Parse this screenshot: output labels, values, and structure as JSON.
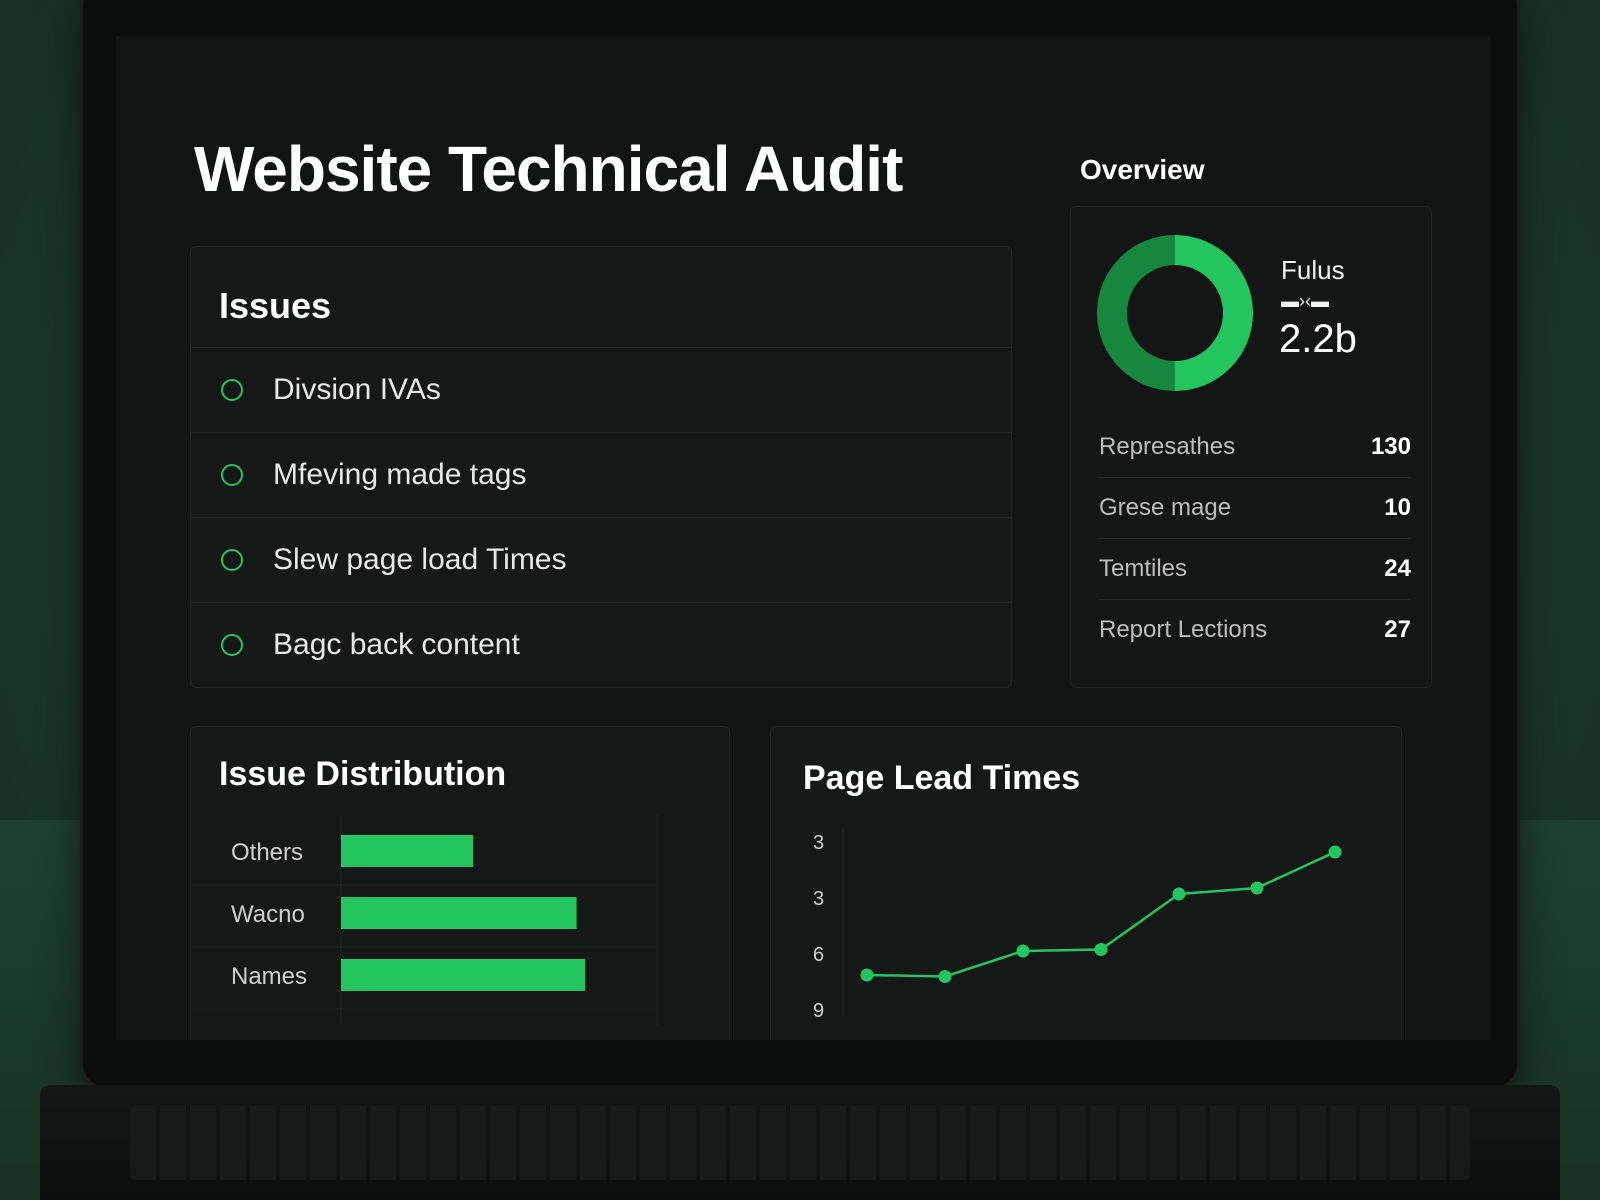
{
  "page": {
    "title": "Website Technical Audit",
    "accent_color": "#22c55e",
    "accent_dark": "#15883e"
  },
  "issues": {
    "heading": "Issues",
    "items": [
      {
        "label": "Divsion IVAs",
        "icon": "circle-icon"
      },
      {
        "label": "Mfeving made tags",
        "icon": "circle-icon"
      },
      {
        "label": "Slew page load Times",
        "icon": "circle-icon"
      },
      {
        "label": "Bagc back content",
        "icon": "circle-icon"
      }
    ]
  },
  "overview": {
    "heading": "Overview",
    "donut_label": "Fulus",
    "donut_glyph": "▬›‹▬",
    "donut_value": "2.2b",
    "stats": [
      {
        "name": "Represathes",
        "value": "130"
      },
      {
        "name": "Grese mage",
        "value": "10"
      },
      {
        "name": "Temtiles",
        "value": "24"
      },
      {
        "name": "Report Lections",
        "value": "27"
      }
    ]
  },
  "chart_data": [
    {
      "type": "bar",
      "orientation": "horizontal",
      "title": "Issue Distribution",
      "categories": [
        "Others",
        "Wacno",
        "Names"
      ],
      "values": [
        2.3,
        4.1,
        4.25
      ],
      "xlim": [
        0,
        5.5
      ],
      "grid": true,
      "color": "#22c55e"
    },
    {
      "type": "line",
      "title": "Page Lead Times",
      "y_tick_labels": [
        "3",
        "3",
        "6",
        "9"
      ],
      "x": [
        1,
        2,
        3,
        4,
        5,
        6,
        7
      ],
      "values": [
        1.0,
        0.95,
        1.8,
        1.85,
        3.7,
        3.9,
        5.1
      ],
      "ylim": [
        0,
        6
      ],
      "grid": true,
      "color": "#22c55e"
    }
  ]
}
